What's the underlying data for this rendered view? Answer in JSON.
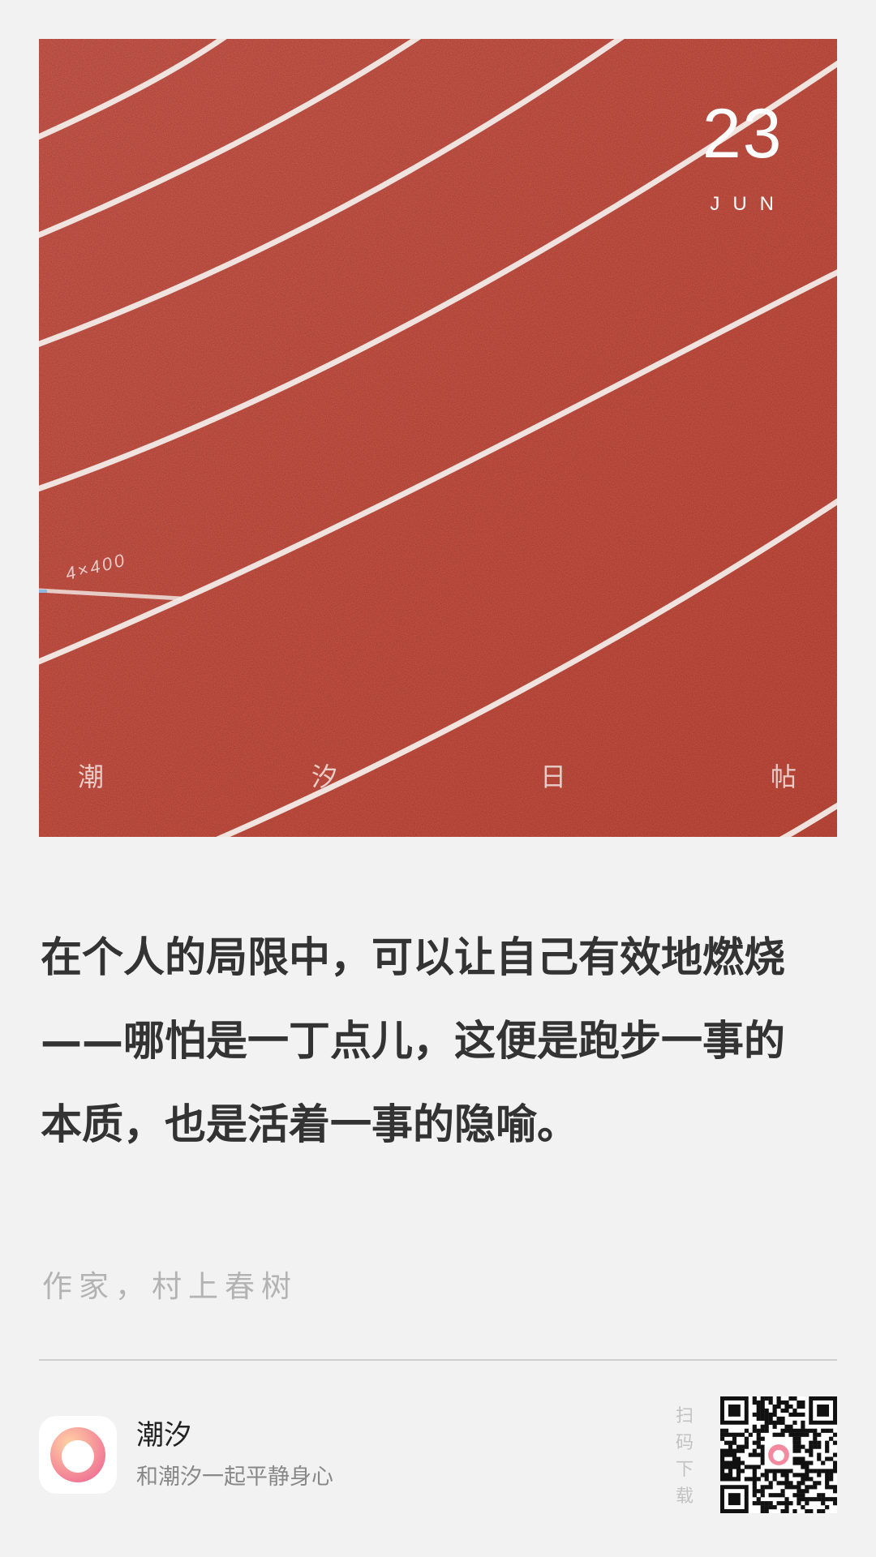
{
  "header": {
    "date_day": "23",
    "date_month": "JUN",
    "brand_chars": [
      "潮",
      "汐",
      "日",
      "帖"
    ],
    "track_marking": "4×400"
  },
  "quote": {
    "text": "在个人的局限中，可以让自己有效地燃烧——哪怕是一丁点儿，这便是跑步一事的本质，也是活着一事的隐喻。",
    "author": "作家，村上春树"
  },
  "footer": {
    "app_name": "潮汐",
    "app_slogan": "和潮汐一起平静身心",
    "scan_label": [
      "扫",
      "码",
      "下",
      "载"
    ]
  },
  "colors": {
    "track": "#d9574a",
    "lane_line": "#f3ece8",
    "background": "#f2f2f2",
    "quote_text": "#333333"
  },
  "icons": {
    "app_icon": "tide-ring-icon",
    "qr": "qr-code-icon"
  }
}
